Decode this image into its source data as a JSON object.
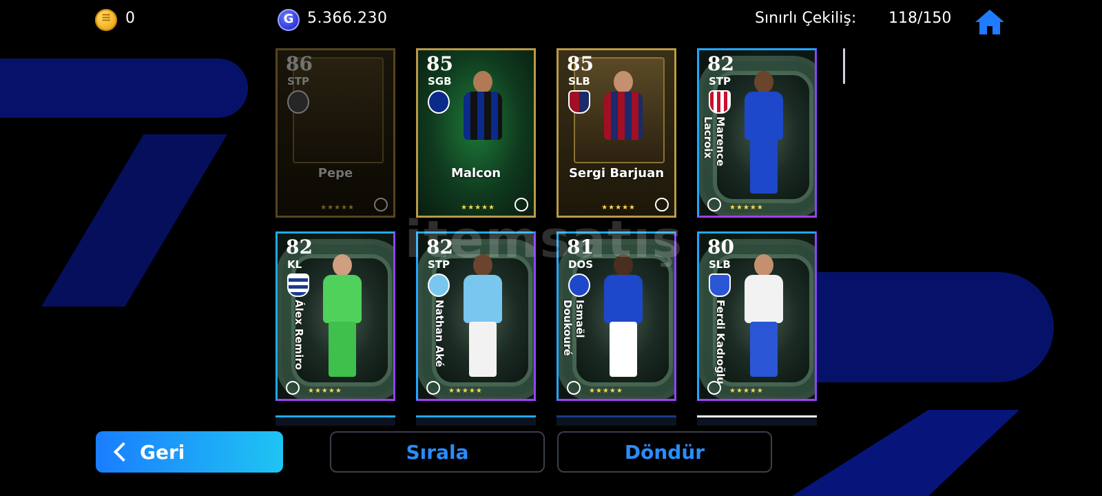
{
  "header": {
    "coins": "0",
    "gp": "5.366.230",
    "draw_label": "Sınırlı Çekiliş:",
    "draw_count": "118/150"
  },
  "cards": [
    {
      "rating": "86",
      "position": "STP",
      "name": "Pepe",
      "stars": "★★★★★"
    },
    {
      "rating": "85",
      "position": "SGB",
      "name": "Malcon",
      "stars": "★★★★★"
    },
    {
      "rating": "85",
      "position": "SLB",
      "name": "Sergi Barjuan",
      "stars": "★★★★★"
    },
    {
      "rating": "82",
      "position": "STP",
      "name": "Marence Lacroix",
      "stars": "★★★★★"
    },
    {
      "rating": "82",
      "position": "KL",
      "name": "Álex Remiro",
      "stars": "★★★★★"
    },
    {
      "rating": "82",
      "position": "STP",
      "name": "Nathan Aké",
      "stars": "★★★★★"
    },
    {
      "rating": "81",
      "position": "DOS",
      "name": "Ismaël Doukouré",
      "stars": "★★★★★"
    },
    {
      "rating": "80",
      "position": "SLB",
      "name": "Ferdi Kadıoğlu",
      "stars": "★★★★★"
    }
  ],
  "buttons": {
    "back": "Geri",
    "sort": "Sırala",
    "rotate": "Döndür"
  },
  "watermark": "itemsatış",
  "icons": {
    "coin": "efootball-coin-icon",
    "gp": "gp-icon",
    "home": "home-icon",
    "back": "chevron-left-icon"
  },
  "colors": {
    "accent": "#2a8cff",
    "back_button": "#1a9cf5",
    "home_icon": "#1f7bff"
  }
}
